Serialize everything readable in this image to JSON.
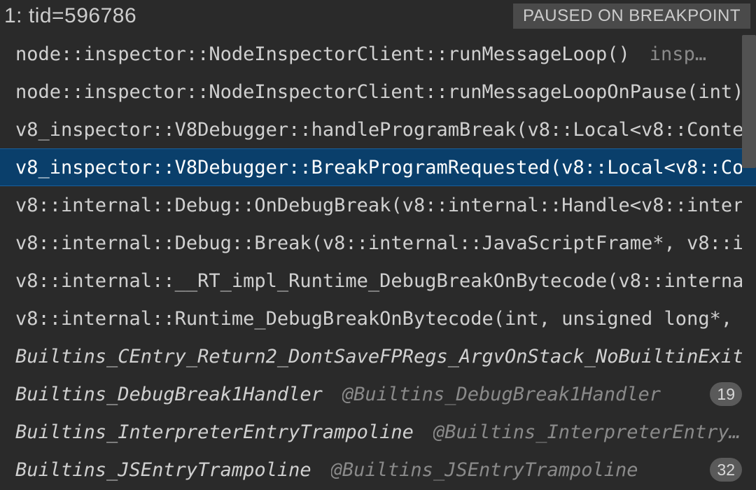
{
  "header": {
    "thread_title": "1: tid=596786",
    "status_badge": "PAUSED ON BREAKPOINT"
  },
  "frames": [
    {
      "label": "node::inspector::NodeInspectorClient::runMessageLoop()",
      "source": "insp…",
      "italic": false,
      "selected": false,
      "line_badge": null
    },
    {
      "label": "node::inspector::NodeInspectorClient::runMessageLoopOnPause(int)",
      "source": "",
      "italic": false,
      "selected": false,
      "line_badge": null
    },
    {
      "label": "v8_inspector::V8Debugger::handleProgramBreak(v8::Local<v8::Conte",
      "source": "",
      "italic": false,
      "selected": false,
      "line_badge": null
    },
    {
      "label": "v8_inspector::V8Debugger::BreakProgramRequested(v8::Local<v8::Co",
      "source": "",
      "italic": false,
      "selected": true,
      "line_badge": null
    },
    {
      "label": "v8::internal::Debug::OnDebugBreak(v8::internal::Handle<v8::inter",
      "source": "",
      "italic": false,
      "selected": false,
      "line_badge": null
    },
    {
      "label": "v8::internal::Debug::Break(v8::internal::JavaScriptFrame*, v8::i",
      "source": "",
      "italic": false,
      "selected": false,
      "line_badge": null
    },
    {
      "label": "v8::internal::__RT_impl_Runtime_DebugBreakOnBytecode(v8::interna",
      "source": "",
      "italic": false,
      "selected": false,
      "line_badge": null
    },
    {
      "label": "v8::internal::Runtime_DebugBreakOnBytecode(int, unsigned long*, ",
      "source": "",
      "italic": false,
      "selected": false,
      "line_badge": null
    },
    {
      "label": "Builtins_CEntry_Return2_DontSaveFPRegs_ArgvOnStack_NoBuiltinExit",
      "source": "",
      "italic": true,
      "selected": false,
      "line_badge": null
    },
    {
      "label": "Builtins_DebugBreak1Handler",
      "source": "@Builtins_DebugBreak1Handler",
      "italic": true,
      "selected": false,
      "line_badge": "19"
    },
    {
      "label": "Builtins_InterpreterEntryTrampoline",
      "source": "@Builtins_InterpreterEntry…",
      "italic": true,
      "selected": false,
      "line_badge": null
    },
    {
      "label": "Builtins_JSEntryTrampoline",
      "source": "@Builtins_JSEntryTrampoline",
      "italic": true,
      "selected": false,
      "line_badge": "32"
    }
  ]
}
